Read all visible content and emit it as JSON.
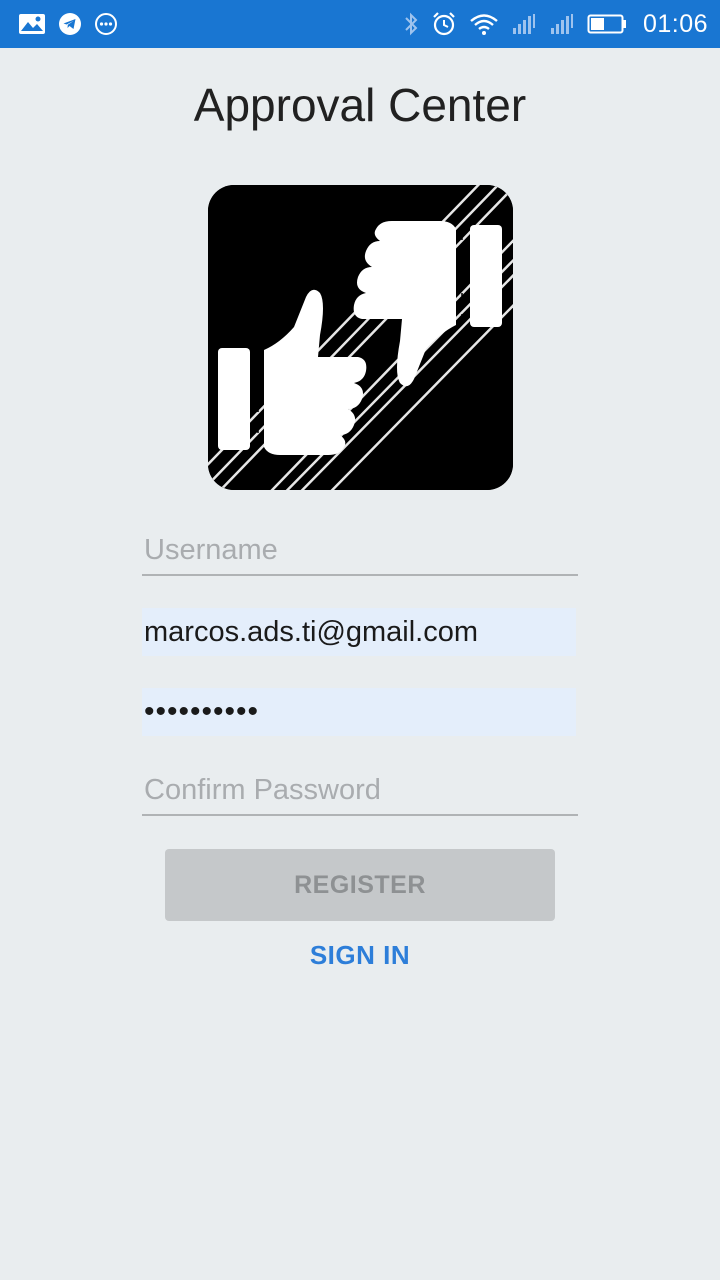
{
  "status_bar": {
    "left_icons": [
      "image-icon",
      "telegram-icon",
      "more-circle-icon"
    ],
    "right_icons": [
      "bluetooth-icon",
      "alarm-icon",
      "wifi-icon",
      "signal-1-icon",
      "signal-2-icon",
      "battery-icon"
    ],
    "time": "01:06",
    "color": "#1976d2"
  },
  "page": {
    "title": "Approval Center"
  },
  "logo": {
    "icon": "thumbs-up-down-icon"
  },
  "form": {
    "username_placeholder": "Username",
    "email_value": "marcos.ads.ti@gmail.com",
    "password_value": "••••••••••",
    "confirm_placeholder": "Confirm Password",
    "register_label": "REGISTER",
    "signin_label": "SIGN IN"
  },
  "colors": {
    "background": "#e9edef",
    "accent": "#2d7ed9",
    "autofill": "#e4eefb",
    "button_disabled": "#c5c8ca"
  }
}
